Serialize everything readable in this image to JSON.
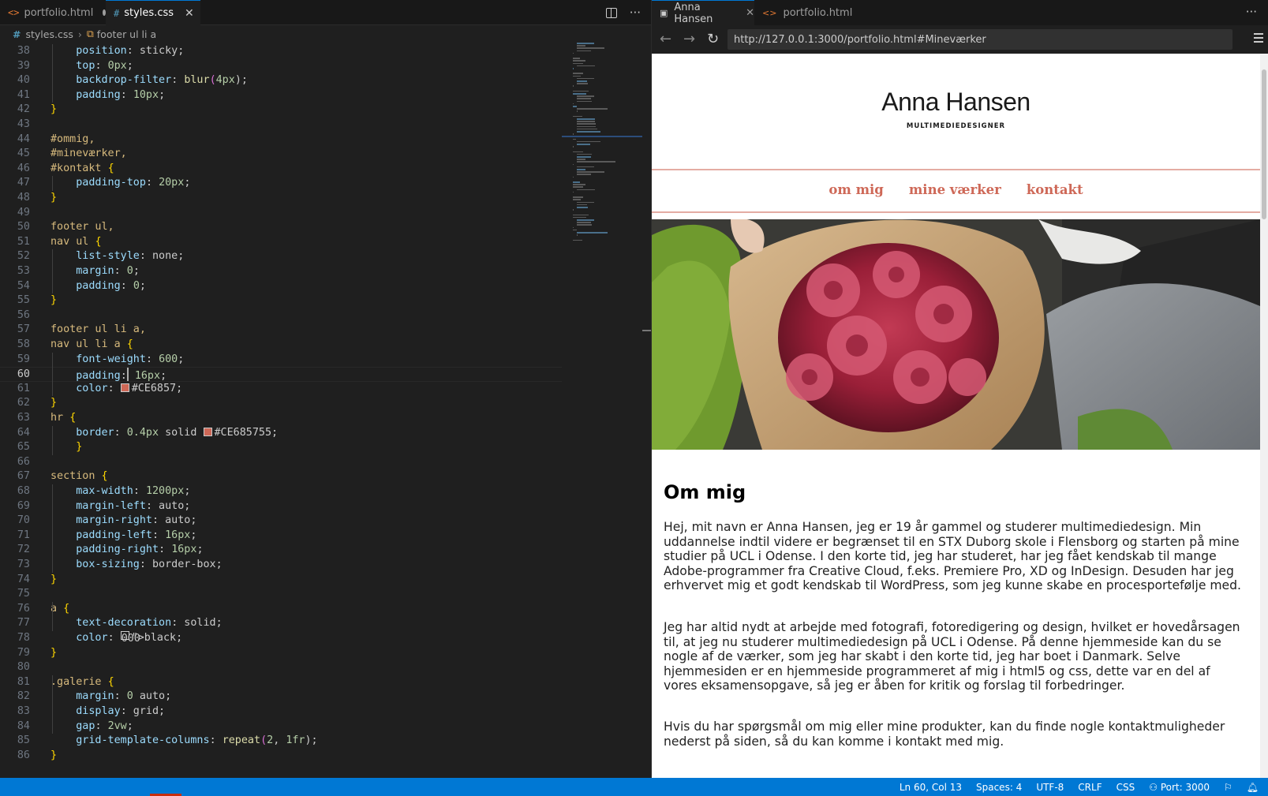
{
  "editor": {
    "tabs": [
      {
        "label": "portfolio.html",
        "icon": "html-file-icon",
        "modified": true
      },
      {
        "label": "styles.css",
        "icon": "css-file-icon",
        "active": true
      }
    ],
    "breadcrumb": {
      "file": "styles.css",
      "symbol": "footer ul li a"
    },
    "current_line": 60,
    "code_lines": [
      {
        "n": "38",
        "t": "    position: sticky;"
      },
      {
        "n": "39",
        "t": "    top: 0px;"
      },
      {
        "n": "40",
        "t": "    backdrop-filter: blur(4px);"
      },
      {
        "n": "41",
        "t": "    padding: 10px;"
      },
      {
        "n": "42",
        "t": "}"
      },
      {
        "n": "43",
        "t": ""
      },
      {
        "n": "44",
        "t": "#ommig,"
      },
      {
        "n": "45",
        "t": "#mineværker,"
      },
      {
        "n": "46",
        "t": "#kontakt {"
      },
      {
        "n": "47",
        "t": "    padding-top: 20px;"
      },
      {
        "n": "48",
        "t": "}"
      },
      {
        "n": "49",
        "t": ""
      },
      {
        "n": "50",
        "t": "footer ul,"
      },
      {
        "n": "51",
        "t": "nav ul {"
      },
      {
        "n": "52",
        "t": "    list-style: none;"
      },
      {
        "n": "53",
        "t": "    margin: 0;"
      },
      {
        "n": "54",
        "t": "    padding: 0;"
      },
      {
        "n": "55",
        "t": "}"
      },
      {
        "n": "56",
        "t": ""
      },
      {
        "n": "57",
        "t": "footer ul li a,"
      },
      {
        "n": "58",
        "t": "nav ul li a {"
      },
      {
        "n": "59",
        "t": "    font-weight: 600;"
      },
      {
        "n": "60",
        "t": "    padding: 16px;"
      },
      {
        "n": "61",
        "t": "    color: #CE6857;"
      },
      {
        "n": "62",
        "t": "}"
      },
      {
        "n": "63",
        "t": "hr {"
      },
      {
        "n": "64",
        "t": "    border: 0.4px solid #CE685755;"
      },
      {
        "n": "65",
        "t": "    }"
      },
      {
        "n": "66",
        "t": ""
      },
      {
        "n": "67",
        "t": "section {"
      },
      {
        "n": "68",
        "t": "    max-width: 1200px;"
      },
      {
        "n": "69",
        "t": "    margin-left: auto;"
      },
      {
        "n": "70",
        "t": "    margin-right: auto;"
      },
      {
        "n": "71",
        "t": "    padding-left: 16px;"
      },
      {
        "n": "72",
        "t": "    padding-right: 16px;"
      },
      {
        "n": "73",
        "t": "    box-sizing: border-box;"
      },
      {
        "n": "74",
        "t": "}"
      },
      {
        "n": "75",
        "t": ""
      },
      {
        "n": "76",
        "t": "a {"
      },
      {
        "n": "77",
        "t": "    text-decoration: solid;"
      },
      {
        "n": "78",
        "t": "    color: black;"
      },
      {
        "n": "79",
        "t": "}"
      },
      {
        "n": "80",
        "t": ""
      },
      {
        "n": "81",
        "t": ".galerie {"
      },
      {
        "n": "82",
        "t": "    margin: 0 auto;"
      },
      {
        "n": "83",
        "t": "    display: grid;"
      },
      {
        "n": "84",
        "t": "    gap: 2vw;"
      },
      {
        "n": "85",
        "t": "    grid-template-columns: repeat(2, 1fr);"
      },
      {
        "n": "86",
        "t": "}"
      }
    ]
  },
  "preview": {
    "tabs": [
      {
        "label": "Anna Hansen",
        "icon": "preview-icon",
        "active": true
      },
      {
        "label": "portfolio.html",
        "icon": "html-file-icon",
        "modified": true
      }
    ],
    "url": "http://127.0.0.1:3000/portfolio.html#Mineværker",
    "site": {
      "title": "Anna Hansen",
      "subtitle": "MULTIMEDIEDESIGNER",
      "nav": [
        "om mig",
        "mine værker",
        "kontakt"
      ],
      "accent": "#CE6857",
      "section_heading": "Om mig",
      "paragraphs": [
        "Hej, mit navn er Anna Hansen, jeg er 19 år gammel og studerer multimediedesign. Min uddannelse indtil videre er begrænset til en STX Duborg skole i Flensborg og starten på mine studier på UCL i Odense. I den korte tid, jeg har studeret, har jeg fået kendskab til mange Adobe-programmer fra Creative Cloud, f.eks. Premiere Pro, XD og InDesign. Desuden har jeg erhvervet mig et godt kendskab til WordPress, som jeg kunne skabe en procesportefølje med.",
        "Jeg har altid nydt at arbejde med fotografi, fotoredigering og design, hvilket er hovedårsagen til, at jeg nu studerer multimediedesign på UCL i Odense. På denne hjemmeside kan du se nogle af de værker, som jeg har skabt i den korte tid, jeg har boet i Danmark. Selve hjemmesiden er en hjemmeside programmeret af mig i html5 og css, dette var en del af vores eksamensopgave, så jeg er åben for kritik og forslag til forbedringer.",
        "Hvis du har spørgsmål om mig eller mine produkter, kan du finde nogle kontaktmuligheder nederst på siden, så du kan komme i kontakt med mig."
      ]
    }
  },
  "statusbar": {
    "position": "Ln 60, Col 13",
    "indent": "Spaces: 4",
    "encoding": "UTF-8",
    "eol": "CRLF",
    "language": "CSS",
    "port": "Port: 3000"
  }
}
